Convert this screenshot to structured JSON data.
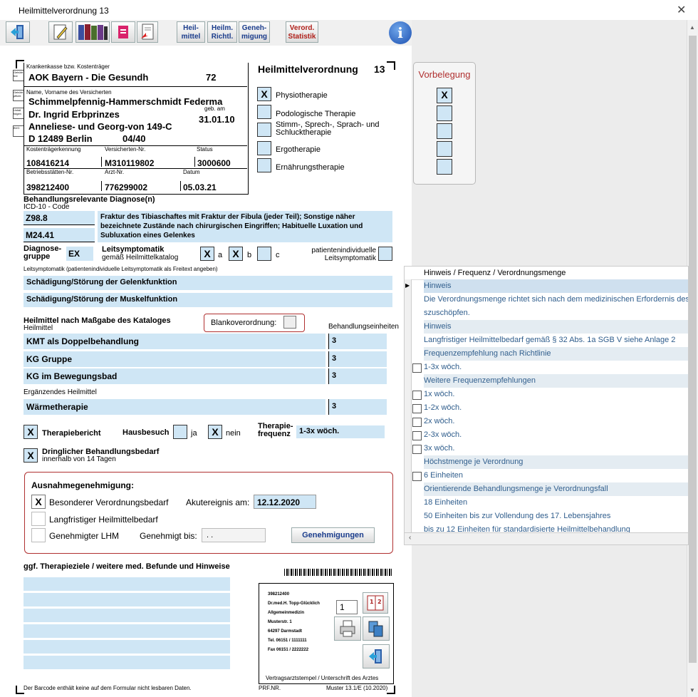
{
  "window": {
    "title": "Heilmittelverordnung 13",
    "close": "✕"
  },
  "toolbar": {
    "heilmittel": [
      "Heil-",
      "mittel"
    ],
    "richtl": [
      "Heilm.",
      "Richtl."
    ],
    "genehmigung": [
      "Geneh-",
      "migung"
    ],
    "statistik": [
      "Verord.",
      "Statistik"
    ],
    "info": "i"
  },
  "header": {
    "kasse_label": "Krankenkasse bzw. Kostenträger",
    "kasse": "AOK Bayern - Die Gesundh",
    "kasse_nr": "72",
    "name_label": "Name, Vorname des Versicherten",
    "name1": "Schimmelpfennig-Hammerschmidt Federma",
    "name2": "Dr. Ingrid Erbprinzes",
    "street": "Anneliese- und Georg-von 149-C",
    "city": "D 12489 Berlin",
    "city_nr": "04/40",
    "geb_label": "geb. am",
    "geb": "31.01.10",
    "kt_label": "Kostenträgerkennung",
    "kt": "108416214",
    "vn_label": "Versicherten-Nr.",
    "vn": "M310119802",
    "status_label": "Status",
    "status": "3000600",
    "bsnr_label": "Betriebsstätten-Nr.",
    "bsnr": "398212400",
    "arzt_label": "Arzt-Nr.",
    "arzt": "776299002",
    "datum_label": "Datum",
    "datum": "05.03.21",
    "side1": "Gebühr frei",
    "side2": "Gebühr pflicht",
    "side3": "Unfall folgen",
    "side4": "BVG"
  },
  "form_title": "Heilmittelverordnung",
  "form_number": "13",
  "therapy_types": [
    {
      "label": "Physiotherapie",
      "mark": "X"
    },
    {
      "label": "Podologische Therapie",
      "mark": ""
    },
    {
      "label": "Stimm-, Sprech-, Sprach- und Schlucktherapie",
      "mark": ""
    },
    {
      "label": "Ergotherapie",
      "mark": ""
    },
    {
      "label": "Ernährungstherapie",
      "mark": ""
    }
  ],
  "vorbelegung": {
    "title": "Vorbelegung",
    "marks": [
      "X",
      "",
      "",
      "",
      ""
    ]
  },
  "diagnose": {
    "heading": "Behandlungsrelevante Diagnose(n)",
    "icd_label": "ICD-10 - Code",
    "icd1": "Z98.8",
    "icd2": "M24.41",
    "text": "Fraktur des Tibiaschaftes mit Fraktur der Fibula (jeder Teil); Sonstige näher bezeichnete Zustände nach chirurgischen Eingriffen; Habituelle Luxation und Subluxation eines Gelenkes",
    "gruppe_label1": "Diagnose-",
    "gruppe_label2": "gruppe",
    "gruppe": "EX",
    "leit_label": "Leitsymptomatik",
    "leit_sub": "gemäß Heilmittelkatalog",
    "a": "X",
    "a_label": "a",
    "b": "X",
    "b_label": "b",
    "c": "",
    "c_label": "c",
    "pi_label1": "patientenindividuelle",
    "pi_label2": "Leitsymptomatik",
    "freitext_label": "Leitsymptomatik (patientenindividuelle Leitsymptomatik als Freitext angeben)",
    "leit1": "Schädigung/Störung der Gelenkfunktion",
    "leit2": "Schädigung/Störung der Muskelfunktion"
  },
  "heilmittel": {
    "heading": "Heilmittel nach Maßgabe des Kataloges",
    "sub": "Heilmittel",
    "blanko_label": "Blankoverordnung:",
    "einheiten_label": "Behandlungseinheiten",
    "items": [
      {
        "name": "KMT als Doppelbehandlung",
        "units": "3"
      },
      {
        "name": "KG Gruppe",
        "units": "3"
      },
      {
        "name": "KG im Bewegungsbad",
        "units": "3"
      }
    ],
    "erg_label": "Ergänzendes Heilmittel",
    "erg": "Wärmetherapie",
    "erg_units": "3"
  },
  "options": {
    "bericht_mark": "X",
    "bericht": "Therapiebericht",
    "hausbesuch": "Hausbesuch",
    "ja": "ja",
    "ja_mark": "",
    "nein": "nein",
    "nein_mark": "X",
    "freq_label1": "Therapie-",
    "freq_label2": "frequenz",
    "freq": "1-3x wöch.",
    "dringlich_mark": "X",
    "dringlich": "Dringlicher Behandlungsbedarf",
    "dringlich_sub": "innerhalb von 14 Tagen"
  },
  "ausnahme": {
    "title": "Ausnahmegenehmigung:",
    "besonderer_mark": "X",
    "besonderer": "Besonderer Verordnungsbedarf",
    "akut_label": "Akutereignis am:",
    "akut": "12.12.2020",
    "lang": "Langfristiger Heilmittelbedarf",
    "lhm": "Genehmigter LHM",
    "gen_bis_label": "Genehmigt bis:",
    "gen_bis": ". .",
    "button": "Genehmigungen"
  },
  "ziele": {
    "heading": "ggf. Therapieziele / weitere med. Befunde und Hinweise",
    "footer": "Der Barcode enthält keine auf dem Formular nicht lesbaren Daten."
  },
  "stamp": {
    "lines": [
      "398212400",
      "Dr.med.H. Topp-Glücklich",
      "Allgemeinmedizin",
      "Musterstr. 1",
      "64297 Darmstadt",
      "Tel. 06151 / 1111111",
      "Fax 06151 / 2222222"
    ],
    "count": "1",
    "label": "Vertragsarztstempel / Unterschrift des Arztes",
    "prf": "PRF.NR.",
    "muster": "Muster 13.1/E (10.2020)"
  },
  "hinweise": {
    "header": "Hinweis / Frequenz / Verordnungsmenge",
    "rows": [
      {
        "text": "Hinweis",
        "kind": "grp",
        "cb": false,
        "sel": true
      },
      {
        "text": "Die Verordnungsmenge richtet sich nach dem medizinischen Erfordernis des Einzelfalls und ist nicht zwingend auszuschöpfen.",
        "kind": "txt",
        "cb": false
      },
      {
        "text": "szuschöpfen.",
        "kind": "txt",
        "cb": false
      },
      {
        "text": "Hinweis",
        "kind": "grp",
        "cb": false
      },
      {
        "text": "Langfristiger Heilmittelbedarf gemäß § 32 Abs. 1a SGB V siehe Anlage 2",
        "kind": "txt",
        "cb": false
      },
      {
        "text": "Frequenzempfehlung nach Richtlinie",
        "kind": "grp",
        "cb": false
      },
      {
        "text": "1-3x wöch.",
        "kind": "txt",
        "cb": true
      },
      {
        "text": "Weitere Frequenzempfehlungen",
        "kind": "grp",
        "cb": false
      },
      {
        "text": "1x wöch.",
        "kind": "txt",
        "cb": true
      },
      {
        "text": "1-2x wöch.",
        "kind": "txt",
        "cb": true
      },
      {
        "text": "2x wöch.",
        "kind": "txt",
        "cb": true
      },
      {
        "text": "2-3x wöch.",
        "kind": "txt",
        "cb": true
      },
      {
        "text": "3x wöch.",
        "kind": "txt",
        "cb": true
      },
      {
        "text": "Höchstmenge je Verordnung",
        "kind": "grp",
        "cb": false
      },
      {
        "text": "6 Einheiten",
        "kind": "txt",
        "cb": true
      },
      {
        "text": "Orientierende Behandlungsmenge je Verordnungsfall",
        "kind": "grp",
        "cb": false
      },
      {
        "text": "18 Einheiten",
        "kind": "txt",
        "cb": false
      },
      {
        "text": "50 Einheiten bis zur Vollendung des 17. Lebensjahres",
        "kind": "txt",
        "cb": false
      },
      {
        "text": "bis zu 12 Einheiten für standardisierte Heilmittelbehandlung",
        "kind": "txt",
        "cb": false
      }
    ]
  }
}
